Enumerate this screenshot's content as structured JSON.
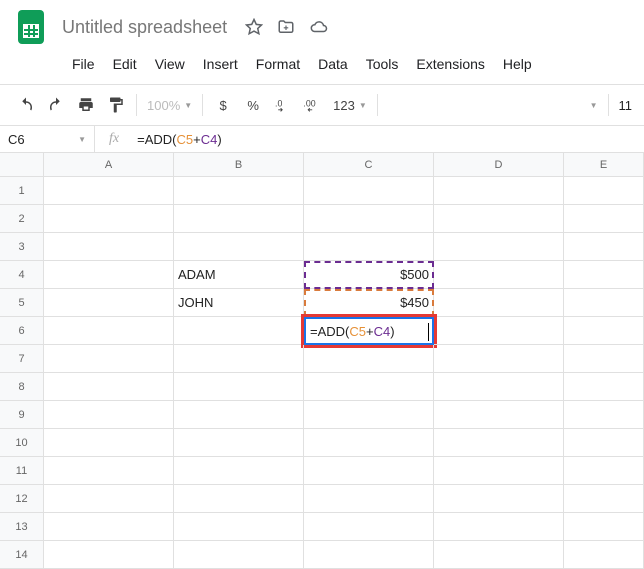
{
  "doc": {
    "title": "Untitled spreadsheet"
  },
  "menu": [
    "File",
    "Edit",
    "View",
    "Insert",
    "Format",
    "Data",
    "Tools",
    "Extensions",
    "Help"
  ],
  "toolbar": {
    "zoom": "100%",
    "currency": "$",
    "percent": "%",
    "num_format": "123",
    "font_size": "11"
  },
  "formula_bar": {
    "cell_ref": "C6",
    "formula_parts": {
      "eq": "=",
      "func": "ADD",
      "paren_open": "(",
      "ref1": "C5",
      "op": "+",
      "ref2": "C4",
      "paren_close": ")"
    }
  },
  "cols": [
    "A",
    "B",
    "C",
    "D",
    "E"
  ],
  "rows": [
    "1",
    "2",
    "3",
    "4",
    "5",
    "6",
    "7",
    "8",
    "9",
    "10",
    "11",
    "12",
    "13",
    "14"
  ],
  "cells": {
    "B4": "ADAM",
    "B5": "JOHN",
    "C4": "$500",
    "C5": "$450"
  }
}
